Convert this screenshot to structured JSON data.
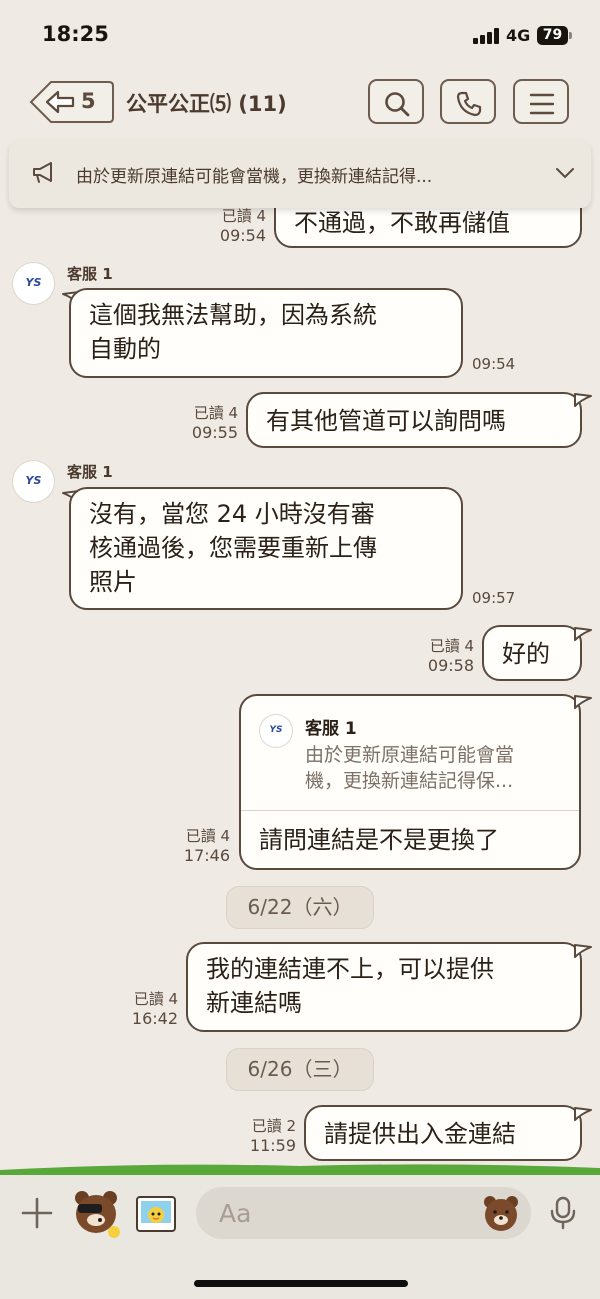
{
  "status_bar": {
    "time": "18:25",
    "network": "4G",
    "battery": "79"
  },
  "header": {
    "back_count": "5",
    "title": "公平公正⑸ (11)",
    "icons": [
      "back-arrow-icon",
      "search-icon",
      "phone-icon",
      "menu-icon"
    ]
  },
  "announcement": {
    "text": "由於更新原連結可能會當機，更換新連結記得..."
  },
  "messages": [
    {
      "side": "right",
      "read": "已讀 4",
      "time": "09:54",
      "text": "不通過，不敢再儲值"
    },
    {
      "side": "left",
      "sender": "客服 1",
      "avatar": "YS",
      "text_lines": [
        "這個我無法幫助，因為系統",
        "自動的"
      ],
      "time": "09:54"
    },
    {
      "side": "right",
      "read": "已讀 4",
      "time": "09:55",
      "text": "有其他管道可以詢問嗎"
    },
    {
      "side": "left",
      "sender": "客服 1",
      "avatar": "YS",
      "text_lines": [
        "沒有，當您 24 小時沒有審",
        "核通過後，您需要重新上傳",
        "照片"
      ],
      "time": "09:57"
    },
    {
      "side": "right",
      "read": "已讀 4",
      "time": "09:58",
      "text": "好的"
    },
    {
      "side": "right",
      "read": "已讀 4",
      "time": "17:46",
      "reply_to": {
        "sender": "客服 1",
        "avatar": "YS",
        "quote_lines": [
          "由於更新原連結可能會當",
          "機，更換新連結記得保..."
        ]
      },
      "text": "請問連結是不是更換了"
    },
    {
      "type": "date",
      "text": "6/22（六）"
    },
    {
      "side": "right",
      "read": "已讀 4",
      "time": "16:42",
      "text_lines": [
        "我的連結連不上，可以提供",
        "新連結嗎"
      ]
    },
    {
      "type": "date",
      "text": "6/26（三）"
    },
    {
      "side": "right",
      "read": "已讀 2",
      "time": "11:59",
      "text": "請提供出入金連結"
    }
  ],
  "composer": {
    "placeholder": "Aa",
    "icons": [
      "plus-icon",
      "bear-sticker-icon",
      "photo-icon",
      "emoji-bear-icon",
      "microphone-icon"
    ]
  }
}
